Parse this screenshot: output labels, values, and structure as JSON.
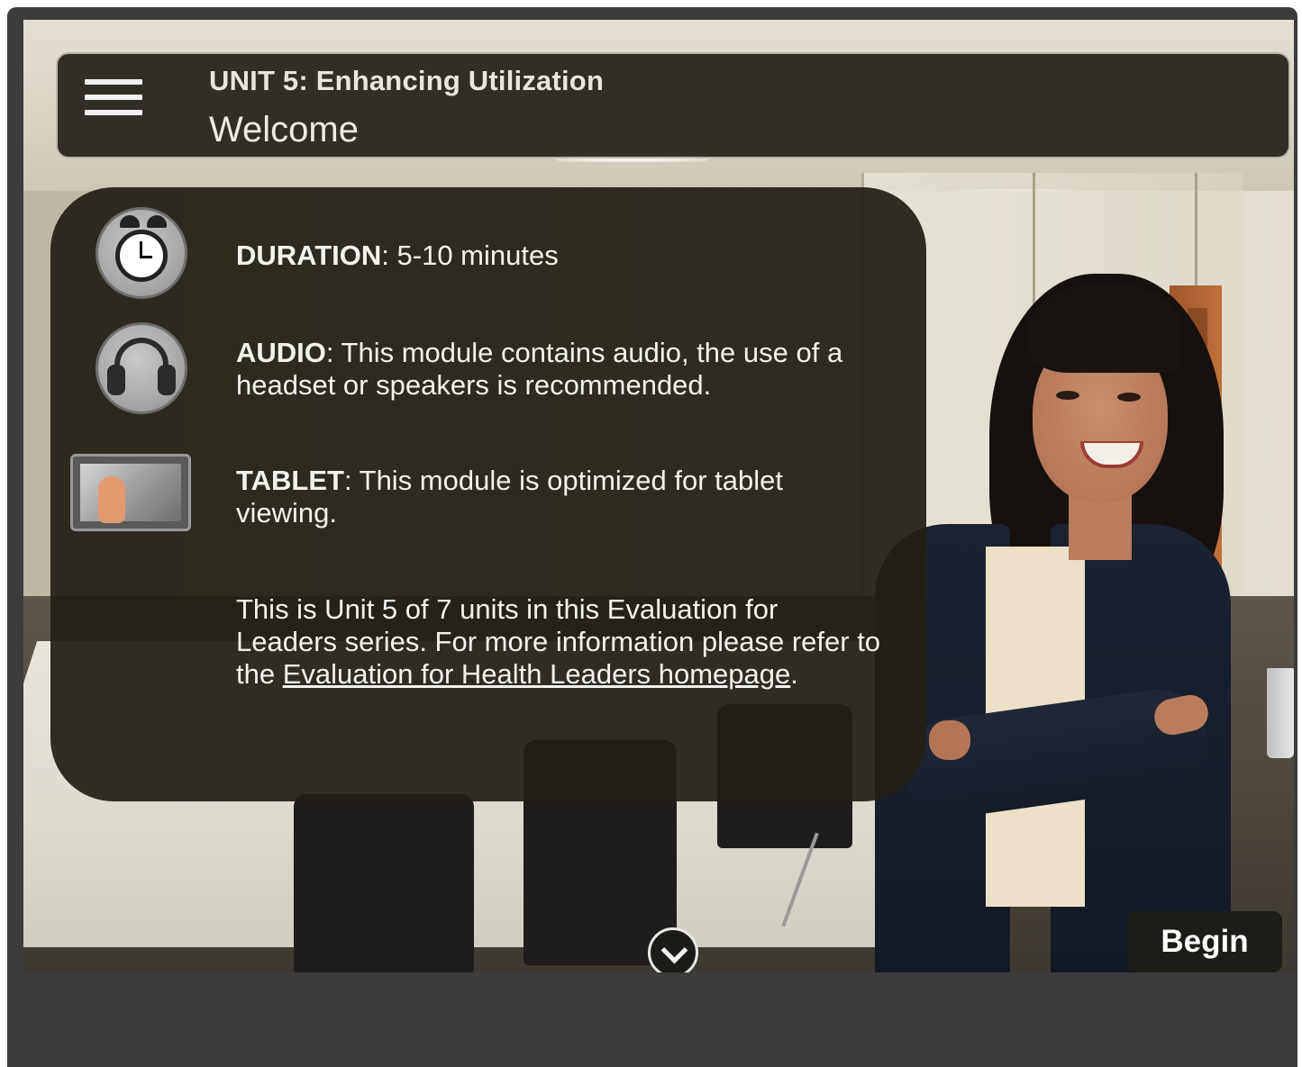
{
  "header": {
    "unit_title": "UNIT 5: Enhancing Utilization",
    "page_title": "Welcome",
    "menu_icon": "hamburger-menu-icon"
  },
  "info": {
    "duration": {
      "label": "DURATION",
      "text": ": 5-10 minutes",
      "icon": "alarm-clock-icon"
    },
    "audio": {
      "label": "AUDIO",
      "text": ": This module contains audio, the use of a headset or speakers is recommended.",
      "icon": "headphones-icon"
    },
    "tablet": {
      "label": "TABLET",
      "text": ": This module is optimized for tablet viewing.",
      "icon": "tablet-touch-icon"
    },
    "series": {
      "text_before": "This is Unit 5 of 7 units in this Evaluation for Leaders series. For more information please refer to the ",
      "link_text": "Evaluation for Health Leaders homepage",
      "text_after": "."
    }
  },
  "controls": {
    "begin_label": "Begin",
    "scroll_icon": "chevron-down-circle-icon"
  },
  "colors": {
    "panel_bg": "#211e16",
    "header_bg": "#222018",
    "frame_bg": "#3c3c3c",
    "text": "#f2f2ee"
  }
}
